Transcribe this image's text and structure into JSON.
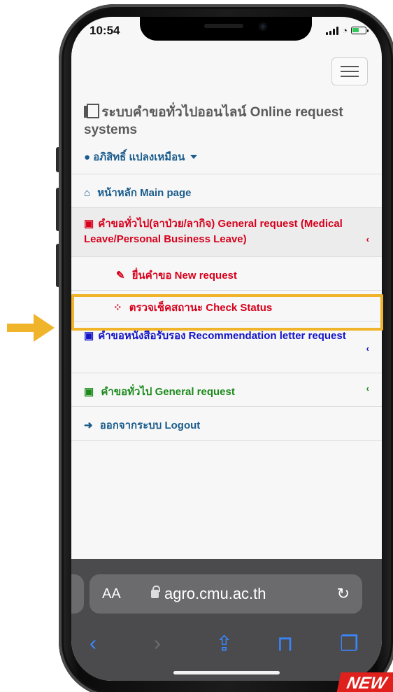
{
  "status_bar": {
    "time": "10:54"
  },
  "header": {
    "title": "ระบบคำขอทั่วไปออนไลน์ Online request systems",
    "user_name": "อภิสิทธิ์ แปลงเหมือน"
  },
  "menu": {
    "home": "หน้าหลัก Main page",
    "general_medical": "คำขอทั่วไป(ลาป่วย/ลากิจ) General request (Medical Leave/Personal Business Leave)",
    "new_request": "ยื่นคำขอ New request",
    "check_status": "ตรวจเช็คสถานะ Check Status",
    "recommendation": "คำขอหนังสือรับรอง Recommendation letter request",
    "general": "คำขอทั่วไป General request",
    "logout": "ออกจากระบบ Logout"
  },
  "browser": {
    "aa_label": "AA",
    "domain": "agro.cmu.ac.th"
  },
  "badge": {
    "text": "NEW"
  },
  "colors": {
    "highlight": "#f0b42a",
    "arrow": "#f0b42a",
    "red": "#d8001c",
    "blue": "#1414c8",
    "green": "#1c8a1c",
    "link": "#1a5c8c",
    "ios_blue": "#3a86ff"
  },
  "icons": [
    "file-icon",
    "user-icon",
    "home-icon",
    "edit-icon",
    "spinner-icon",
    "logout-icon",
    "chevron-left-icon",
    "lock-icon",
    "reload-icon",
    "back-icon",
    "forward-icon",
    "share-icon",
    "bookmarks-icon",
    "tabs-icon",
    "hamburger-icon"
  ]
}
